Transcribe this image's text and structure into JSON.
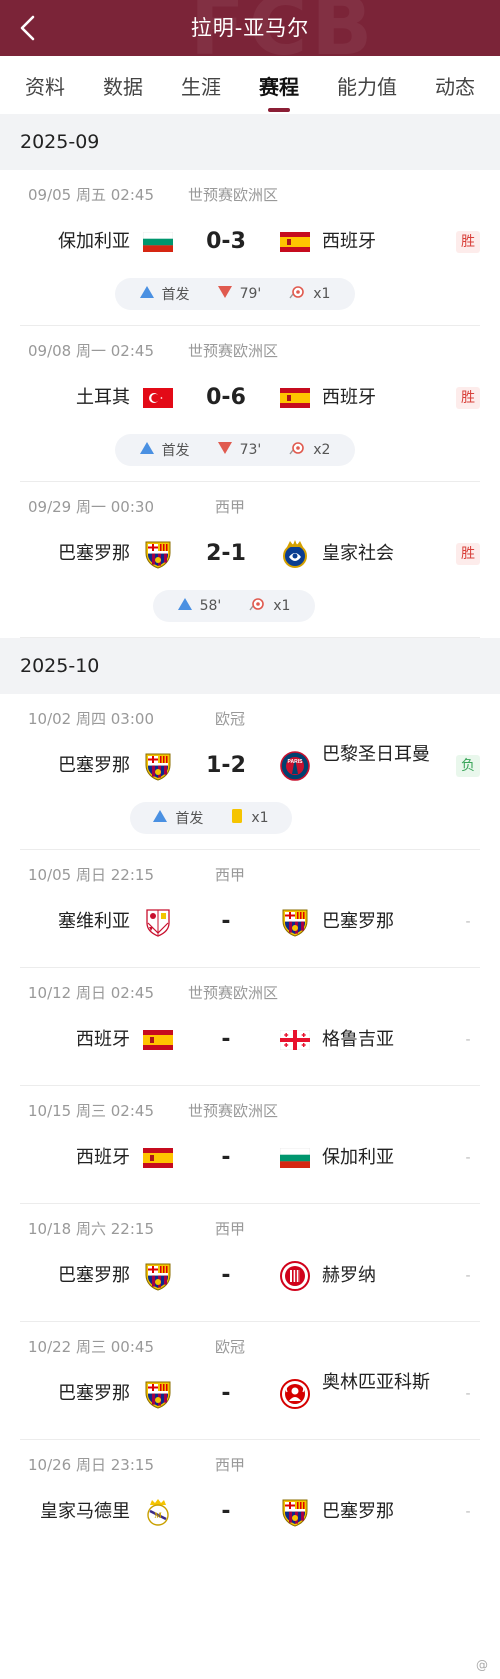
{
  "header": {
    "title": "拉明-亚马尔"
  },
  "tabs": [
    "资料",
    "数据",
    "生涯",
    "赛程",
    "能力值",
    "动态"
  ],
  "months": [
    {
      "label": "2025-09",
      "matches": [
        {
          "date": "09/05 周五 02:45",
          "competition": "世预赛欧洲区",
          "home": "保加利亚",
          "home_logo": "bulgaria-flag",
          "score": "0-3",
          "away": "西班牙",
          "away_logo": "spain-flag",
          "result": "胜",
          "stats": {
            "start": "首发",
            "sub_off": "79'",
            "goals": "x1"
          }
        },
        {
          "date": "09/08 周一 02:45",
          "competition": "世预赛欧洲区",
          "home": "土耳其",
          "home_logo": "turkey-flag",
          "score": "0-6",
          "away": "西班牙",
          "away_logo": "spain-flag",
          "result": "胜",
          "stats": {
            "start": "首发",
            "sub_off": "73'",
            "goals": "x2"
          }
        },
        {
          "date": "09/29 周一 00:30",
          "competition": "西甲",
          "home": "巴塞罗那",
          "home_logo": "barcelona-crest",
          "score": "2-1",
          "away": "皇家社会",
          "away_logo": "real-sociedad-crest",
          "result": "胜",
          "stats": {
            "sub_on": "58'",
            "goals": "x1"
          }
        }
      ]
    },
    {
      "label": "2025-10",
      "matches": [
        {
          "date": "10/02 周四 03:00",
          "competition": "欧冠",
          "home": "巴塞罗那",
          "home_logo": "barcelona-crest",
          "score": "1-2",
          "away": "巴黎圣日耳曼",
          "away_logo": "psg-crest",
          "result": "负",
          "stats": {
            "start": "首发",
            "yellow": "x1"
          }
        },
        {
          "date": "10/05 周日 22:15",
          "competition": "西甲",
          "home": "塞维利亚",
          "home_logo": "sevilla-crest",
          "score": "-",
          "away": "巴塞罗那",
          "away_logo": "barcelona-crest",
          "result": "-"
        },
        {
          "date": "10/12 周日 02:45",
          "competition": "世预赛欧洲区",
          "home": "西班牙",
          "home_logo": "spain-flag",
          "score": "-",
          "away": "格鲁吉亚",
          "away_logo": "georgia-flag",
          "result": "-"
        },
        {
          "date": "10/15 周三 02:45",
          "competition": "世预赛欧洲区",
          "home": "西班牙",
          "home_logo": "spain-flag",
          "score": "-",
          "away": "保加利亚",
          "away_logo": "bulgaria-flag",
          "result": "-"
        },
        {
          "date": "10/18 周六 22:15",
          "competition": "西甲",
          "home": "巴塞罗那",
          "home_logo": "barcelona-crest",
          "score": "-",
          "away": "赫罗纳",
          "away_logo": "girona-crest",
          "result": "-"
        },
        {
          "date": "10/22 周三 00:45",
          "competition": "欧冠",
          "home": "巴塞罗那",
          "home_logo": "barcelona-crest",
          "score": "-",
          "away": "奥林匹亚科斯",
          "away_logo": "olympiacos-crest",
          "result": "-"
        },
        {
          "date": "10/26 周日 23:15",
          "competition": "西甲",
          "home": "皇家马德里",
          "home_logo": "real-madrid-crest",
          "score": "-",
          "away": "巴塞罗那",
          "away_logo": "barcelona-crest",
          "result": "-"
        }
      ]
    }
  ],
  "colors": {
    "header_bg": "#7b2438",
    "accent": "#8b1e35",
    "win": "#d8403a",
    "loss": "#3aa55a",
    "start_icon": "#4a90e2",
    "sub_off_icon": "#e05a4f"
  }
}
